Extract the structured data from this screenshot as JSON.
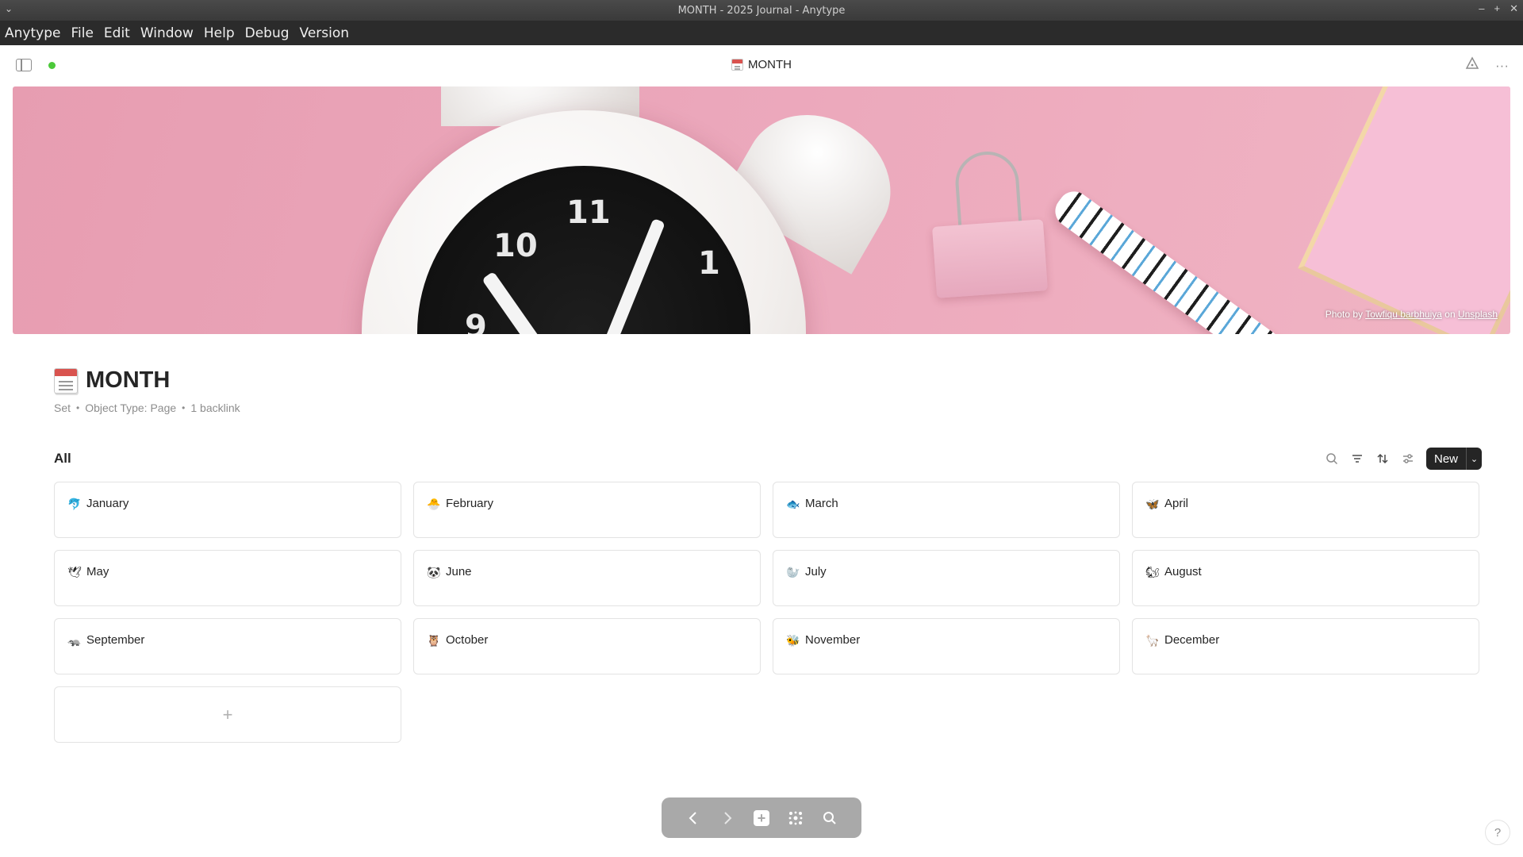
{
  "window": {
    "title": "MONTH - 2025 Journal - Anytype"
  },
  "menubar": [
    "Anytype",
    "File",
    "Edit",
    "Window",
    "Help",
    "Debug",
    "Version"
  ],
  "header": {
    "title": "MONTH"
  },
  "cover": {
    "credit_prefix": "Photo by",
    "credit_author": "Towfiqu barbhuiya",
    "credit_on": "on",
    "credit_source": "Unsplash"
  },
  "page": {
    "title": "MONTH",
    "meta": [
      "Set",
      "Object Type: Page",
      "1 backlink"
    ]
  },
  "view": {
    "title": "All",
    "new_label": "New"
  },
  "cards": [
    {
      "emoji": "🐬",
      "name": "January"
    },
    {
      "emoji": "🐣",
      "name": "February"
    },
    {
      "emoji": "🐟",
      "name": "March"
    },
    {
      "emoji": "🦋",
      "name": "April"
    },
    {
      "emoji": "🕊",
      "name": "May"
    },
    {
      "emoji": "🐼",
      "name": "June"
    },
    {
      "emoji": "🦭",
      "name": "July"
    },
    {
      "emoji": "🐿",
      "name": "August"
    },
    {
      "emoji": "🦡",
      "name": "September"
    },
    {
      "emoji": "🦉",
      "name": "October"
    },
    {
      "emoji": "🐝",
      "name": "November"
    },
    {
      "emoji": "🦙",
      "name": "December"
    }
  ],
  "add_card_label": "+",
  "help_label": "?"
}
